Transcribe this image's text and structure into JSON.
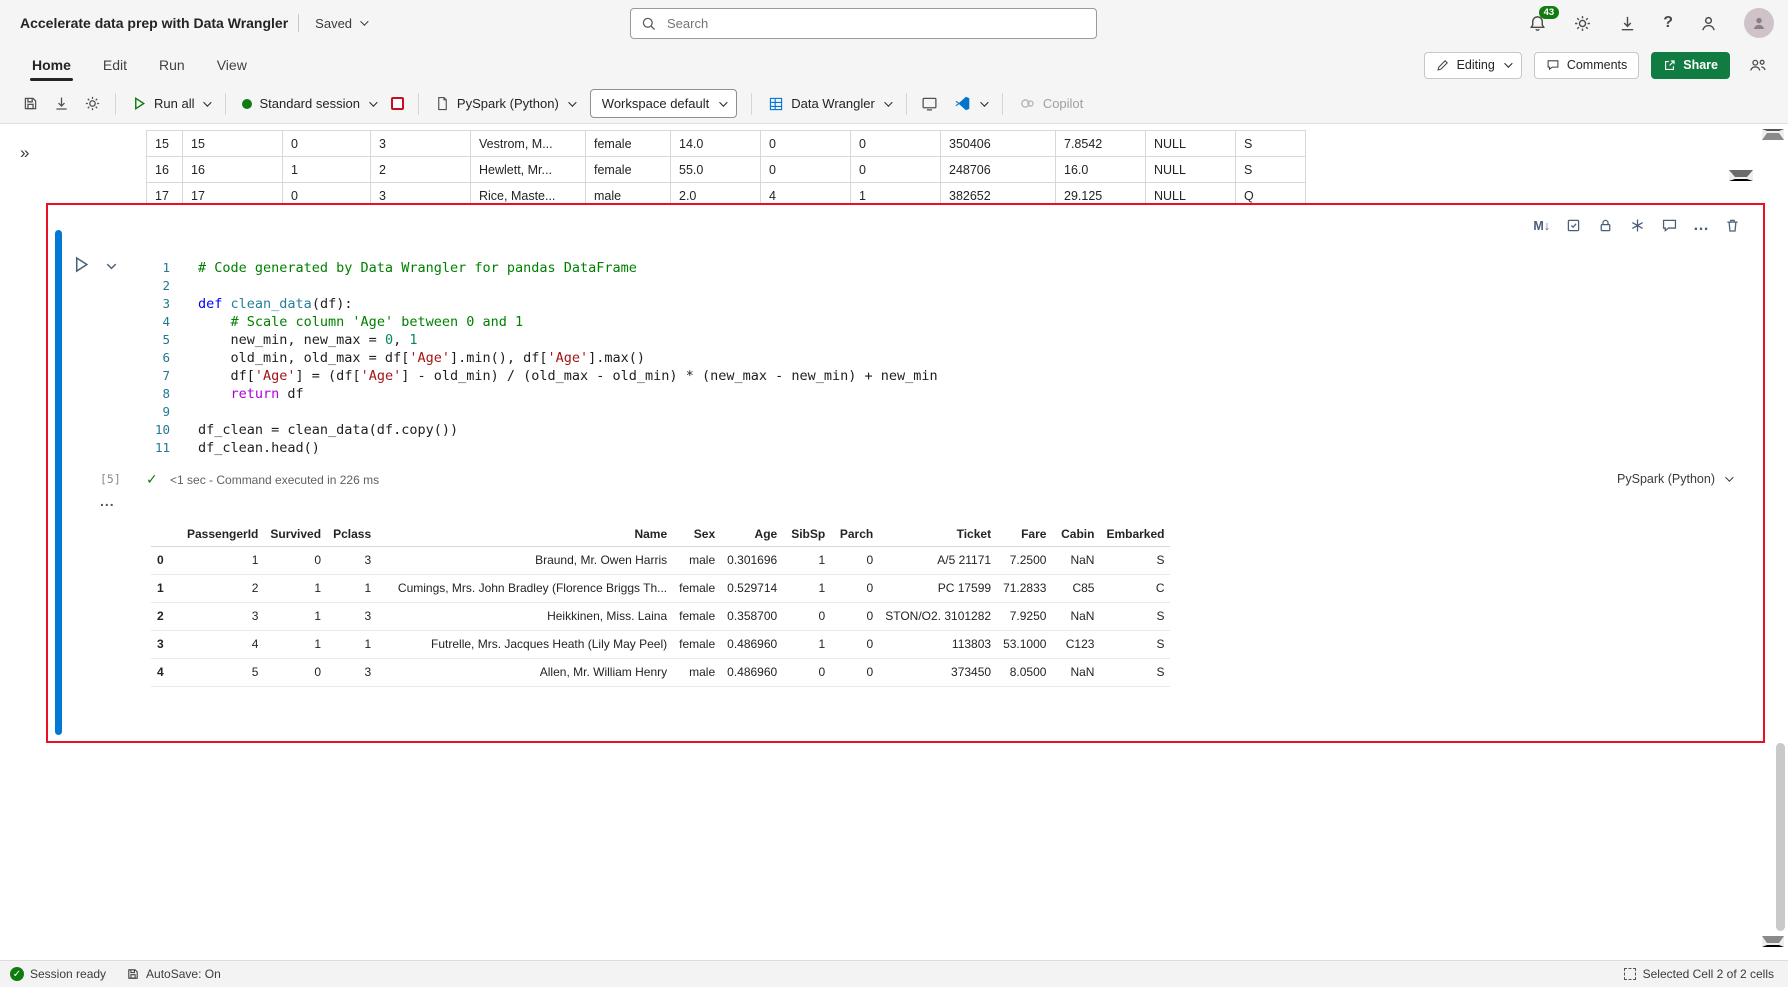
{
  "colors": {
    "accent": "#0078d4",
    "selection_red": "#e81123",
    "stop_red": "#c50f1f",
    "session_green": "#107c10",
    "share_green": "#107c41",
    "syn_comment": "#008000",
    "syn_keyword": "#0000ff",
    "syn_control": "#af00db",
    "syn_function": "#267f99",
    "syn_string": "#a31515",
    "syn_number": "#098658",
    "syn_linenum": "#237893"
  },
  "titlebar": {
    "title": "Accelerate data prep with Data Wrangler",
    "save_status": "Saved",
    "search_placeholder": "Search",
    "notification_count": "43",
    "help_glyph": "?"
  },
  "menubar": {
    "tabs": [
      "Home",
      "Edit",
      "Run",
      "View"
    ],
    "active_tab": "Home",
    "editing_label": "Editing",
    "comments_label": "Comments",
    "share_label": "Share"
  },
  "toolbar": {
    "run_all_label": "Run all",
    "session_label": "Standard session",
    "kernel_label": "PySpark (Python)",
    "workspace_label": "Workspace default",
    "data_wrangler_label": "Data Wrangler",
    "copilot_label": "Copilot"
  },
  "glyphs": {
    "expand_rail": "»",
    "markdown_cell": "M↓",
    "more": "…",
    "check": "✓",
    "output_more": "..."
  },
  "top_table": {
    "rows": [
      [
        "15",
        "15",
        "0",
        "3",
        "Vestrom, M...",
        "female",
        "14.0",
        "0",
        "0",
        "350406",
        "7.8542",
        "NULL",
        "S"
      ],
      [
        "16",
        "16",
        "1",
        "2",
        "Hewlett, Mr...",
        "female",
        "55.0",
        "0",
        "0",
        "248706",
        "16.0",
        "NULL",
        "S"
      ],
      [
        "17",
        "17",
        "0",
        "3",
        "Rice, Maste...",
        "male",
        "2.0",
        "4",
        "1",
        "382652",
        "29.125",
        "NULL",
        "Q"
      ]
    ]
  },
  "cell": {
    "execution_count": "[5]",
    "status_text": "<1 sec - Command executed in 226 ms",
    "kernel_label": "PySpark (Python)",
    "code": [
      {
        "n": "1",
        "t": [
          {
            "c": "cm",
            "s": "# Code generated by Data Wrangler for pandas DataFrame"
          }
        ]
      },
      {
        "n": "2",
        "t": []
      },
      {
        "n": "3",
        "t": [
          {
            "c": "kw",
            "s": "def"
          },
          {
            "c": "pl",
            "s": " "
          },
          {
            "c": "fn",
            "s": "clean_data"
          },
          {
            "c": "pl",
            "s": "(df):"
          }
        ]
      },
      {
        "n": "4",
        "t": [
          {
            "c": "pl",
            "s": "    "
          },
          {
            "c": "cm",
            "s": "# Scale column 'Age' between 0 and 1"
          }
        ]
      },
      {
        "n": "5",
        "t": [
          {
            "c": "pl",
            "s": "    new_min, new_max = "
          },
          {
            "c": "num",
            "s": "0"
          },
          {
            "c": "pl",
            "s": ", "
          },
          {
            "c": "num",
            "s": "1"
          }
        ]
      },
      {
        "n": "6",
        "t": [
          {
            "c": "pl",
            "s": "    old_min, old_max = df["
          },
          {
            "c": "str",
            "s": "'Age'"
          },
          {
            "c": "pl",
            "s": "].min(), df["
          },
          {
            "c": "str",
            "s": "'Age'"
          },
          {
            "c": "pl",
            "s": "].max()"
          }
        ]
      },
      {
        "n": "7",
        "t": [
          {
            "c": "pl",
            "s": "    df["
          },
          {
            "c": "str",
            "s": "'Age'"
          },
          {
            "c": "pl",
            "s": "] = (df["
          },
          {
            "c": "str",
            "s": "'Age'"
          },
          {
            "c": "pl",
            "s": "] - old_min) / (old_max - old_min) * (new_max - new_min) + new_min"
          }
        ]
      },
      {
        "n": "8",
        "t": [
          {
            "c": "pl",
            "s": "    "
          },
          {
            "c": "kw2",
            "s": "return"
          },
          {
            "c": "pl",
            "s": " df"
          }
        ]
      },
      {
        "n": "9",
        "t": []
      },
      {
        "n": "10",
        "t": [
          {
            "c": "pl",
            "s": "df_clean = clean_data(df.copy())"
          }
        ]
      },
      {
        "n": "11",
        "t": [
          {
            "c": "pl",
            "s": "df_clean.head()"
          }
        ]
      }
    ]
  },
  "output_table": {
    "headers": [
      "",
      "PassengerId",
      "Survived",
      "Pclass",
      "Name",
      "Sex",
      "Age",
      "SibSp",
      "Parch",
      "Ticket",
      "Fare",
      "Cabin",
      "Embarked"
    ],
    "rows": [
      [
        "0",
        "1",
        "0",
        "3",
        "Braund, Mr. Owen Harris",
        "male",
        "0.301696",
        "1",
        "0",
        "A/5 21171",
        "7.2500",
        "NaN",
        "S"
      ],
      [
        "1",
        "2",
        "1",
        "1",
        "Cumings, Mrs. John Bradley (Florence Briggs Th...",
        "female",
        "0.529714",
        "1",
        "0",
        "PC 17599",
        "71.2833",
        "C85",
        "C"
      ],
      [
        "2",
        "3",
        "1",
        "3",
        "Heikkinen, Miss. Laina",
        "female",
        "0.358700",
        "0",
        "0",
        "STON/O2. 3101282",
        "7.9250",
        "NaN",
        "S"
      ],
      [
        "3",
        "4",
        "1",
        "1",
        "Futrelle, Mrs. Jacques Heath (Lily May Peel)",
        "female",
        "0.486960",
        "1",
        "0",
        "113803",
        "53.1000",
        "C123",
        "S"
      ],
      [
        "4",
        "5",
        "0",
        "3",
        "Allen, Mr. William Henry",
        "male",
        "0.486960",
        "0",
        "0",
        "373450",
        "8.0500",
        "NaN",
        "S"
      ]
    ]
  },
  "statusbar": {
    "session_status": "Session ready",
    "autosave": "AutoSave: On",
    "selection_info": "Selected Cell 2 of 2 cells"
  }
}
